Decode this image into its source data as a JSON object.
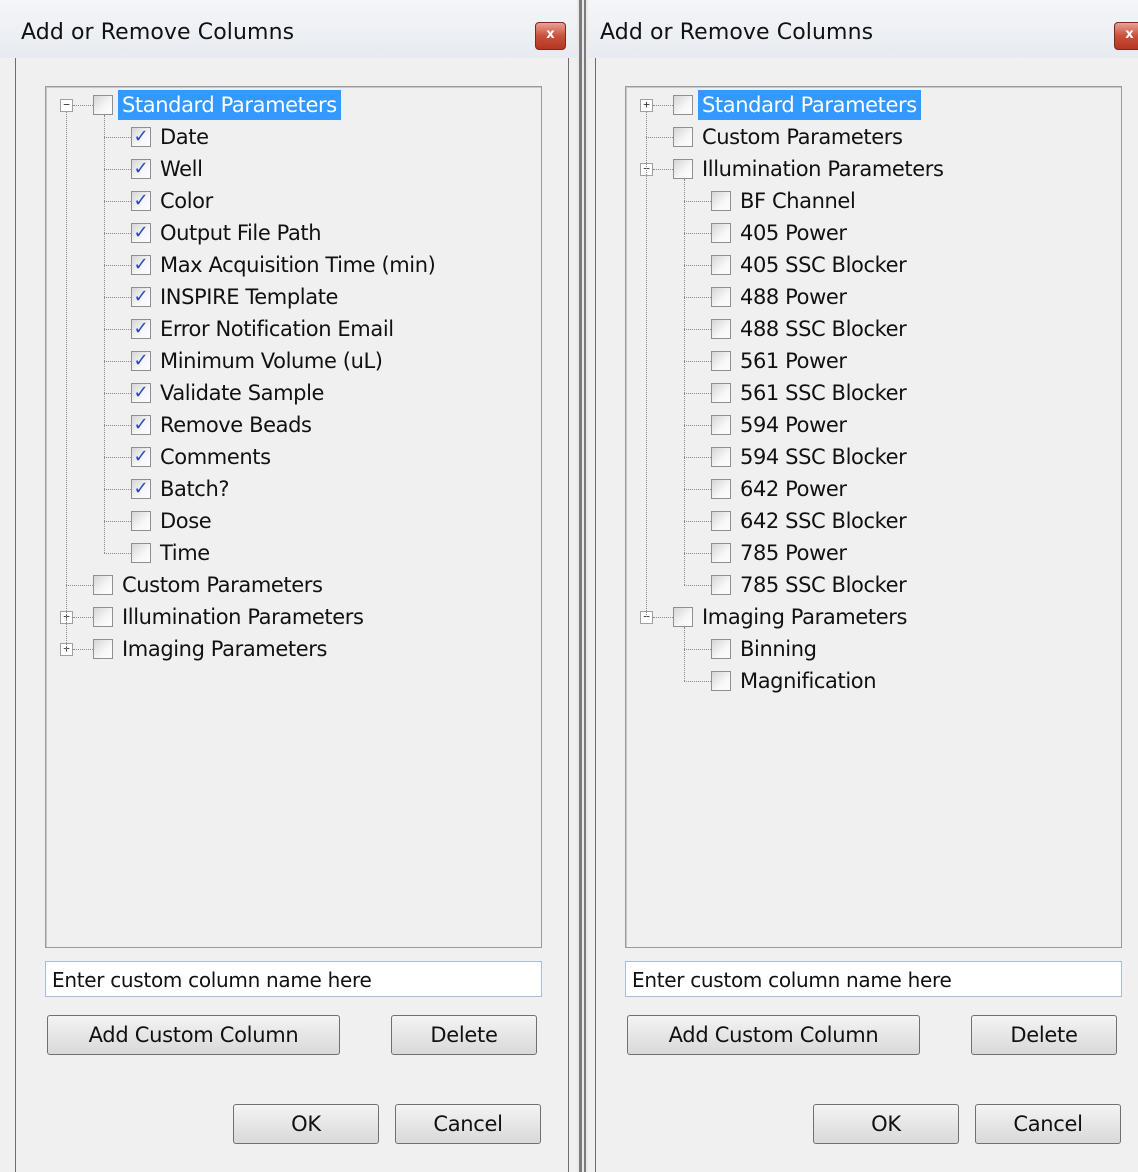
{
  "left_dialog": {
    "title": "Add or Remove Columns",
    "close_glyph": "x",
    "tree": [
      {
        "label": "Standard Parameters",
        "expanded": true,
        "checked": false,
        "selected": true,
        "children": [
          {
            "label": "Date",
            "checked": true
          },
          {
            "label": "Well",
            "checked": true
          },
          {
            "label": "Color",
            "checked": true
          },
          {
            "label": "Output File Path",
            "checked": true
          },
          {
            "label": "Max Acquisition Time (min)",
            "checked": true
          },
          {
            "label": "INSPIRE Template",
            "checked": true
          },
          {
            "label": "Error Notification Email",
            "checked": true
          },
          {
            "label": "Minimum Volume (uL)",
            "checked": true
          },
          {
            "label": "Validate Sample",
            "checked": true
          },
          {
            "label": "Remove Beads",
            "checked": true
          },
          {
            "label": "Comments",
            "checked": true
          },
          {
            "label": "Batch?",
            "checked": true
          },
          {
            "label": "Dose",
            "checked": false
          },
          {
            "label": "Time",
            "checked": false
          }
        ]
      },
      {
        "label": "Custom Parameters",
        "checked": false,
        "children": []
      },
      {
        "label": "Illumination Parameters",
        "expanded": false,
        "checked": false,
        "collapsed_children": true
      },
      {
        "label": "Imaging Parameters",
        "expanded": false,
        "checked": false,
        "collapsed_children": true
      }
    ],
    "custom_column_placeholder": "Enter custom column name here",
    "add_custom_column_label": "Add Custom Column",
    "delete_label": "Delete",
    "ok_label": "OK",
    "cancel_label": "Cancel"
  },
  "right_dialog": {
    "title": "Add or Remove Columns",
    "close_glyph": "x",
    "tree": [
      {
        "label": "Standard Parameters",
        "expanded": false,
        "checked": false,
        "selected": true,
        "collapsed_children": true
      },
      {
        "label": "Custom Parameters",
        "checked": false,
        "children": []
      },
      {
        "label": "Illumination Parameters",
        "expanded": true,
        "checked": false,
        "children": [
          {
            "label": "BF Channel",
            "checked": false
          },
          {
            "label": "405 Power",
            "checked": false
          },
          {
            "label": "405 SSC Blocker",
            "checked": false
          },
          {
            "label": "488 Power",
            "checked": false
          },
          {
            "label": "488 SSC Blocker",
            "checked": false
          },
          {
            "label": "561 Power",
            "checked": false
          },
          {
            "label": "561 SSC Blocker",
            "checked": false
          },
          {
            "label": "594 Power",
            "checked": false
          },
          {
            "label": "594 SSC Blocker",
            "checked": false
          },
          {
            "label": "642 Power",
            "checked": false
          },
          {
            "label": "642 SSC Blocker",
            "checked": false
          },
          {
            "label": "785 Power",
            "checked": false
          },
          {
            "label": "785 SSC Blocker",
            "checked": false
          }
        ]
      },
      {
        "label": "Imaging Parameters",
        "expanded": true,
        "checked": false,
        "children": [
          {
            "label": "Binning",
            "checked": false
          },
          {
            "label": "Magnification",
            "checked": false
          }
        ]
      }
    ],
    "custom_column_placeholder": "Enter custom column name here",
    "add_custom_column_label": "Add Custom Column",
    "delete_label": "Delete",
    "ok_label": "OK",
    "cancel_label": "Cancel"
  }
}
